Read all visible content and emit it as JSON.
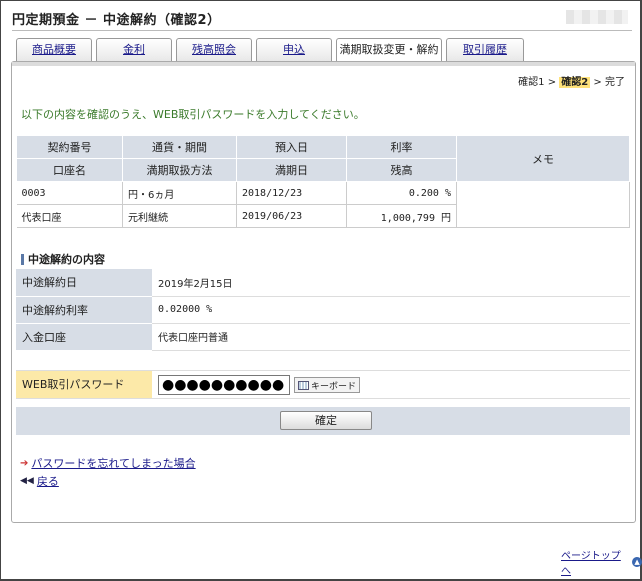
{
  "page": {
    "title": "円定期預金 － 中途解約（確認2）"
  },
  "tabs": [
    {
      "label": "商品概要"
    },
    {
      "label": "金利"
    },
    {
      "label": "残高照会"
    },
    {
      "label": "申込"
    },
    {
      "label": "満期取扱変更・解約"
    },
    {
      "label": "取引履歴"
    }
  ],
  "steps": {
    "step1": "確認1",
    "sep1": ">",
    "step2": "確認2",
    "sep2": ">",
    "step3": "完了"
  },
  "notice": "以下の内容を確認のうえ、WEB取引パスワードを入力してください。",
  "deposit_table": {
    "headers_row1": [
      "契約番号",
      "通貨・期間",
      "預入日",
      "利率"
    ],
    "headers_row2": [
      "口座名",
      "満期取扱方法",
      "満期日",
      "残高"
    ],
    "memo_header": "メモ",
    "row1": {
      "contract_no": "0003",
      "currency_term": "円・6ヵ月",
      "deposit_date": "2018/12/23",
      "rate": "0.200 %"
    },
    "row2": {
      "account_name": "代表口座",
      "maturity_method": "元利継続",
      "maturity_date": "2019/06/23",
      "balance": "1,000,799 円"
    }
  },
  "cancel_section": {
    "title": "中途解約の内容",
    "rows": [
      {
        "label": "中途解約日",
        "value": "2019年2月15日"
      },
      {
        "label": "中途解約利率",
        "value": "0.02000 %"
      },
      {
        "label": "入金口座",
        "value": "代表口座円普通"
      }
    ]
  },
  "password": {
    "label": "WEB取引パスワード",
    "value": "●●●●●●●●●●",
    "keyboard_label": "キーボード"
  },
  "confirm_button": "確定",
  "links": {
    "forgot_password": "パスワードを忘れてしまった場合",
    "back": "戻る",
    "page_top": "ページトップへ"
  }
}
